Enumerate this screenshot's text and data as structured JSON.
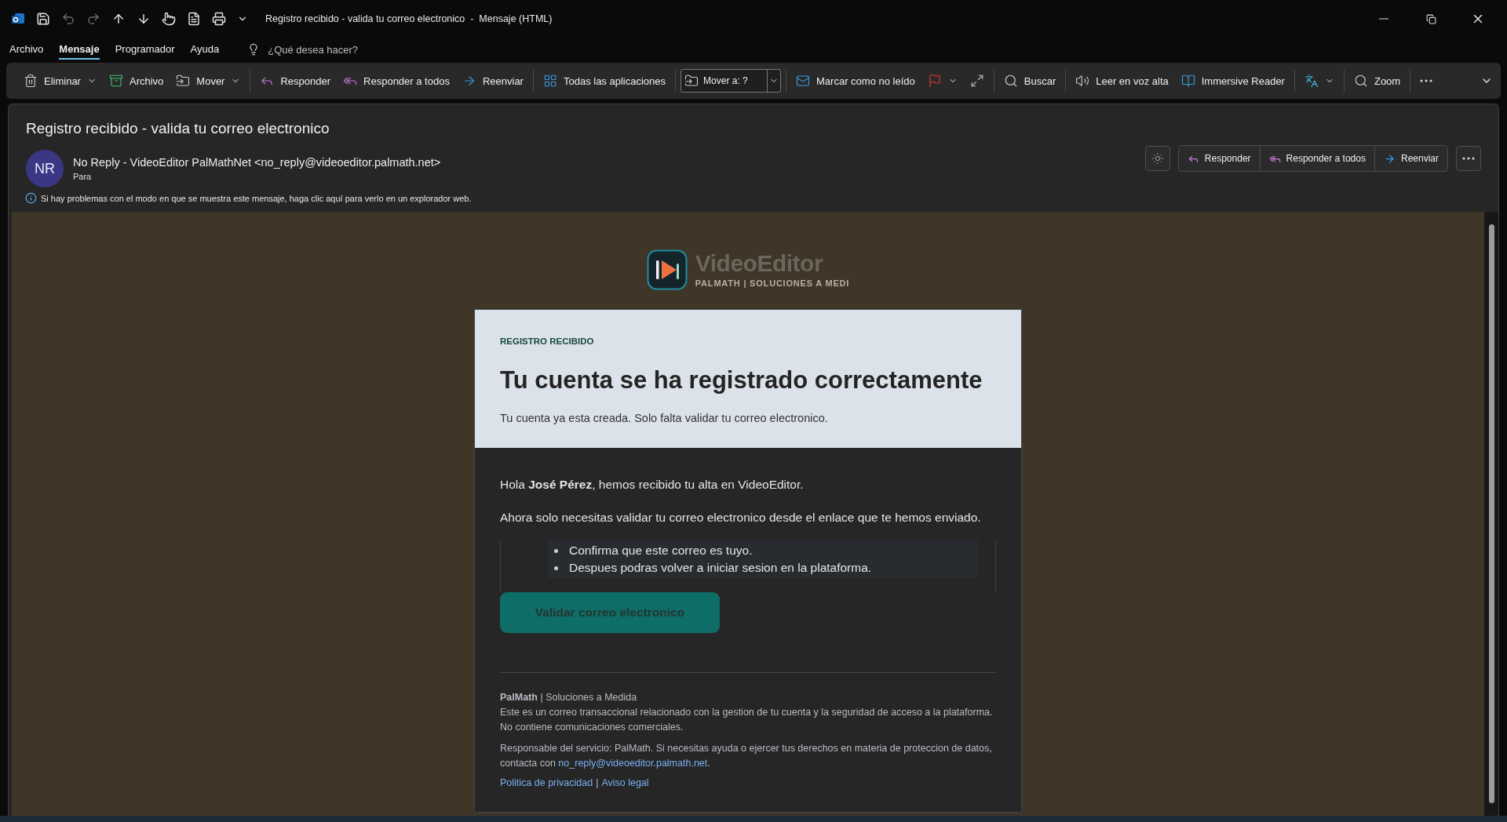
{
  "window": {
    "title": "Registro recibido - valida tu correo electronico  -  Mensaje (HTML)"
  },
  "menu_tabs": [
    {
      "label": "Archivo",
      "selected": false
    },
    {
      "label": "Mensaje",
      "selected": true
    },
    {
      "label": "Programador",
      "selected": false
    },
    {
      "label": "Ayuda",
      "selected": false
    }
  ],
  "tell_me": {
    "placeholder": "¿Qué desea hacer?"
  },
  "ribbon": {
    "groups": [
      [
        {
          "kind": "button",
          "label": "Eliminar",
          "dropdown": true
        },
        {
          "kind": "button",
          "label": "Archivo",
          "dropdown": false
        },
        {
          "kind": "button",
          "label": "Mover",
          "dropdown": true
        }
      ],
      [
        {
          "kind": "button",
          "label": "Responder",
          "dropdown": false
        },
        {
          "kind": "button",
          "label": "Responder a todos",
          "dropdown": false
        },
        {
          "kind": "button",
          "label": "Reenviar",
          "dropdown": false
        }
      ],
      [
        {
          "kind": "button",
          "label": "Todas las aplicaciones",
          "dropdown": false
        }
      ],
      [
        {
          "kind": "combo",
          "value": "Mover a: ?"
        }
      ],
      [
        {
          "kind": "button",
          "label": "Marcar como no leído",
          "dropdown": false
        },
        {
          "kind": "icon_button",
          "dropdown": true
        },
        {
          "kind": "icon_button",
          "dropdown": false
        }
      ],
      [
        {
          "kind": "button",
          "label": "Buscar",
          "dropdown": false
        }
      ],
      [
        {
          "kind": "button",
          "label": "Leer en voz alta",
          "dropdown": false
        },
        {
          "kind": "button",
          "label": "Immersive Reader",
          "dropdown": false
        }
      ],
      [
        {
          "kind": "icon_button",
          "dropdown": true
        }
      ],
      [
        {
          "kind": "button",
          "label": "Zoom",
          "dropdown": false
        }
      ],
      [
        {
          "kind": "icon_button",
          "dropdown": false
        }
      ]
    ]
  },
  "message": {
    "subject": "Registro recibido - valida tu correo electronico",
    "sender": {
      "initials": "NR",
      "name": "No Reply - VideoEditor PalMathNet <no_reply@videoeditor.palmath.net>",
      "recipient_label": "Para"
    },
    "info_bar": "Si hay problemas con el modo en que se muestra este mensaje, haga clic aquí para verlo en un explorador web.",
    "actions": [
      "Responder",
      "Responder a todos",
      "Reenviar"
    ]
  },
  "email": {
    "logo": {
      "name": "VideoEditor",
      "tagline": "PALMATH | SOLUCIONES A MEDI"
    },
    "eyebrow": "REGISTRO RECIBIDO",
    "heading": "Tu cuenta se ha registrado correctamente",
    "subheading": "Tu cuenta ya esta creada. Solo falta validar tu correo electronico.",
    "greeting": "Hola **José Pérez**, hemos recibido tu alta en VideoEditor.",
    "paragraph": "Ahora solo necesitas validar tu correo electronico desde el enlace que te hemos enviado.",
    "bullets": [
      "Confirma que este correo es tuyo.",
      "Despues podras volver a iniciar sesion en la plataforma."
    ],
    "button": "Validar correo electronico",
    "footer": {
      "brand": "**PalMath** | Soluciones a Medida",
      "notice": "Este es un correo transaccional relacionado con la gestion de tu cuenta y la seguridad de acceso a la plataforma. No contiene comunicaciones comerciales.",
      "responsible": {
        "text": "Responsable del servicio: PalMath. Si necesitas ayuda o ejercer tus derechos en materia de proteccion de datos, contacta con ",
        "link": "no_reply@videoeditor.palmath.net",
        "after": "."
      },
      "links": [
        {
          "label": "Politica de privacidad"
        },
        {
          "label": "Aviso legal"
        }
      ],
      "link_separator": "|"
    }
  }
}
